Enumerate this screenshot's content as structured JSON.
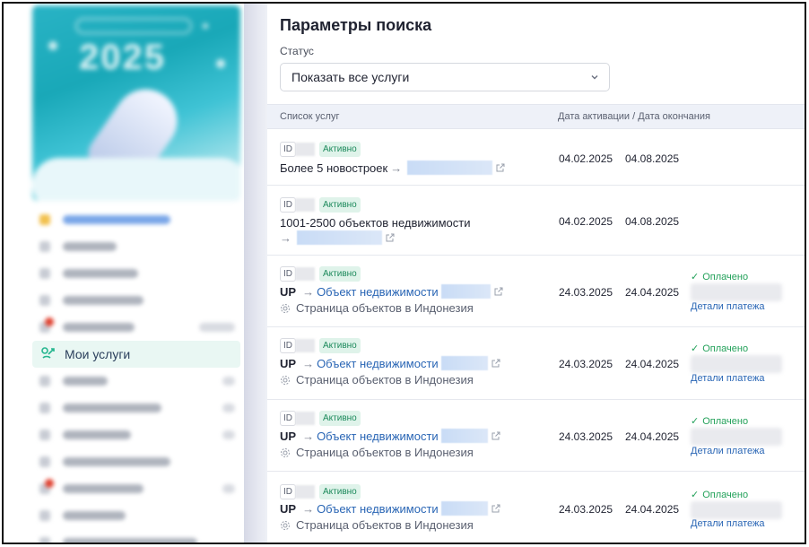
{
  "sidebar": {
    "banner_year": "2025",
    "active_item_label": "Мои услуги"
  },
  "search": {
    "title": "Параметры поиска",
    "status_label": "Статус",
    "status_value": "Показать все услуги"
  },
  "table": {
    "col_services": "Список услуг",
    "col_dates": "Дата активации / Дата окончания",
    "rows": [
      {
        "id_label": "ID",
        "status": "Активно",
        "prefix": "",
        "name": "Более 5 новостроек",
        "linked": false,
        "sub": "",
        "date_start": "04.02.2025",
        "date_end": "04.08.2025",
        "paid": "",
        "details": ""
      },
      {
        "id_label": "ID",
        "status": "Активно",
        "prefix": "",
        "name": "1001-2500 объектов недвижимости",
        "linked": false,
        "sub": "",
        "date_start": "04.02.2025",
        "date_end": "04.08.2025",
        "paid": "",
        "details": ""
      },
      {
        "id_label": "ID",
        "status": "Активно",
        "prefix": "UP",
        "name": "Объект недвижимости",
        "linked": true,
        "sub": "Страница объектов в Индонезия",
        "date_start": "24.03.2025",
        "date_end": "24.04.2025",
        "paid": "Оплачено",
        "details": "Детали платежа"
      },
      {
        "id_label": "ID",
        "status": "Активно",
        "prefix": "UP",
        "name": "Объект недвижимости",
        "linked": true,
        "sub": "Страница объектов в Индонезия",
        "date_start": "24.03.2025",
        "date_end": "24.04.2025",
        "paid": "Оплачено",
        "details": "Детали платежа"
      },
      {
        "id_label": "ID",
        "status": "Активно",
        "prefix": "UP",
        "name": "Объект недвижимости",
        "linked": true,
        "sub": "Страница объектов в Индонезия",
        "date_start": "24.03.2025",
        "date_end": "24.04.2025",
        "paid": "Оплачено",
        "details": "Детали платежа"
      },
      {
        "id_label": "ID",
        "status": "Активно",
        "prefix": "UP",
        "name": "Объект недвижимости",
        "linked": true,
        "sub": "Страница объектов в Индонезия",
        "date_start": "24.03.2025",
        "date_end": "24.04.2025",
        "paid": "Оплачено",
        "details": "Детали платежа"
      }
    ]
  }
}
